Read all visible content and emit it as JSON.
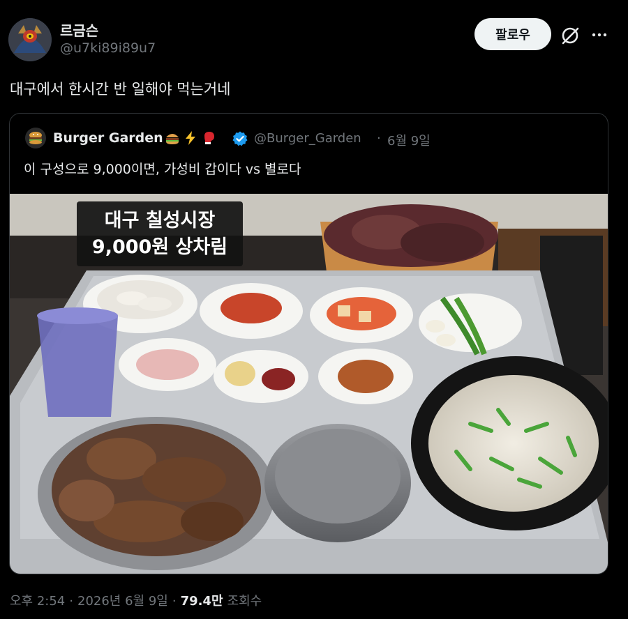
{
  "author": {
    "display_name": "르금슨",
    "handle": "@u7ki89i89u7",
    "avatar_icon": "dragon-avatar"
  },
  "actions": {
    "follow_label": "팔로우",
    "grok_icon": "grok-icon",
    "more_icon": "more-icon"
  },
  "tweet": {
    "text": "대구에서 한시간 반 일해야 먹는거네"
  },
  "quote": {
    "display_name": "Burger Garden",
    "emojis": [
      "burger-icon",
      "lightning-icon",
      "boxing-glove-icon"
    ],
    "verified_icon": "verified-badge-icon",
    "handle": "@Burger_Garden",
    "separator": "·",
    "date": "6월 9일",
    "text": "이 구성으로 9,000이면, 가성비 갑이다 vs 별로다",
    "photo": {
      "caption_line1": "대구 칠성시장",
      "caption_line2": "9,000원 상차림"
    }
  },
  "footer": {
    "time": "오후 2:54",
    "sep1": "·",
    "date": "2026년 6월 9일",
    "sep2": "·",
    "views": "79.4만",
    "views_label": "조회수"
  },
  "colors": {
    "background": "#000000",
    "text": "#e7e9ea",
    "muted": "#71767b",
    "verified": "#1d9bf0",
    "follow_bg": "#eff3f4"
  }
}
